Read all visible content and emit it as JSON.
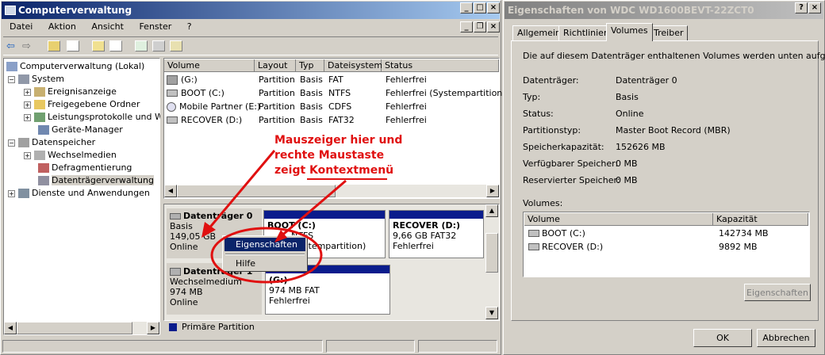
{
  "left_window": {
    "title": "Computerverwaltung",
    "menu": [
      "Datei",
      "Aktion",
      "Ansicht",
      "Fenster",
      "?"
    ],
    "tree": {
      "root": "Computerverwaltung (Lokal)",
      "system": "System",
      "event_viewer": "Ereignisanzeige",
      "shared_folders": "Freigegebene Ordner",
      "perf_logs": "Leistungsprotokolle und Warnungen",
      "device_manager": "Geräte-Manager",
      "storage": "Datenspeicher",
      "removable": "Wechselmedien",
      "defrag": "Defragmentierung",
      "disk_mgmt": "Datenträgerverwaltung",
      "services": "Dienste und Anwendungen"
    },
    "volume_table": {
      "headers": [
        "Volume",
        "Layout",
        "Typ",
        "Dateisystem",
        "Status"
      ],
      "rows": [
        [
          "(G:)",
          "Partition",
          "Basis",
          "FAT",
          "Fehlerfrei"
        ],
        [
          "BOOT (C:)",
          "Partition",
          "Basis",
          "NTFS",
          "Fehlerfrei (Systempartition)"
        ],
        [
          "Mobile Partner (E:)",
          "Partition",
          "Basis",
          "CDFS",
          "Fehlerfrei"
        ],
        [
          "RECOVER (D:)",
          "Partition",
          "Basis",
          "FAT32",
          "Fehlerfrei"
        ]
      ]
    },
    "disk0": {
      "name": "Datenträger 0",
      "type": "Basis",
      "size": "149,05 GB",
      "status": "Online",
      "boot_title": "BOOT (C:)",
      "boot_line2": "NTFS",
      "boot_line3": "(Systempartition)",
      "recover_title": "RECOVER (D:)",
      "recover_line2": "9,66 GB FAT32",
      "recover_line3": "Fehlerfrei"
    },
    "disk1": {
      "name": "Datenträger 1",
      "type": "Wechselmedium",
      "size": "974 MB",
      "status": "Online",
      "vol_title": "(G:)",
      "vol_line2": "974 MB FAT",
      "vol_line3": "Fehlerfrei"
    },
    "legend": "Primäre Partition",
    "context_menu": [
      "Eigenschaften",
      "Hilfe"
    ],
    "annotation": [
      "Mauszeiger hier und",
      "rechte Maustaste",
      "zeigt ",
      "Kontextmenü"
    ]
  },
  "right_window": {
    "title": "Eigenschaften von WDC WD1600BEVT-22ZCT0",
    "tabs": [
      "Allgemein",
      "Richtlinien",
      "Volumes",
      "Treiber"
    ],
    "active_tab": "Volumes",
    "intro": "Die auf diesem Datenträger enthaltenen Volumes werden unten aufgeführt.",
    "props": [
      [
        "Datenträger:",
        "Datenträger 0"
      ],
      [
        "Typ:",
        "Basis"
      ],
      [
        "Status:",
        "Online"
      ],
      [
        "Partitionstyp:",
        "Master Boot Record (MBR)"
      ],
      [
        "Speicherkapazität:",
        "152626 MB"
      ],
      [
        "Verfügbarer Speicher:",
        "0 MB"
      ],
      [
        "Reservierter Speicher:",
        "0 MB"
      ]
    ],
    "volumes_label": "Volumes:",
    "vol_headers": [
      "Volume",
      "Kapazität"
    ],
    "vol_rows": [
      [
        "BOOT (C:)",
        "142734 MB"
      ],
      [
        "RECOVER (D:)",
        "9892 MB"
      ]
    ],
    "btn_props": "Eigenschaften",
    "btn_ok": "OK",
    "btn_cancel": "Abbrechen"
  },
  "colors": {
    "title_active": "#0a246a",
    "partition": "#0a1c8c",
    "annotation": "#e01010"
  }
}
